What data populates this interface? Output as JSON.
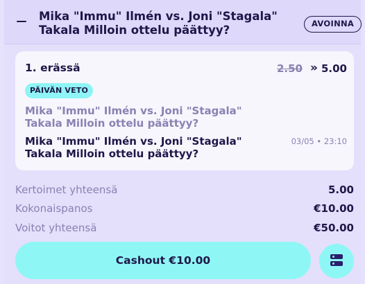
{
  "header": {
    "title": "Mika \"Immu\" Ilmén vs. Joni \"Stagala\" Takala Milloin ottelu päättyy?",
    "status_badge": "AVOINNA"
  },
  "selection": {
    "period": "1. erässä",
    "odds_old": "2.50",
    "odds_arrow": "»",
    "odds_new": "5.00",
    "promo_badge": "PÄIVÄN VETO",
    "market_muted": "Mika \"Immu\" Ilmén vs. Joni \"Stagala\" Takala Milloin ottelu päättyy?",
    "market_main": "Mika \"Immu\" Ilmén vs. Joni \"Stagala\" Takala Milloin ottelu päättyy?",
    "event_time": "03/05 • 23:10"
  },
  "summary": [
    {
      "label": "Kertoimet yhteensä",
      "value": "5.00"
    },
    {
      "label": "Kokonaispanos",
      "value": "€10.00"
    },
    {
      "label": "Voitot yhteensä",
      "value": "€50.00"
    }
  ],
  "actions": {
    "cashout_label": "Cashout €10.00",
    "slip_icon": "betslip-icon"
  },
  "colors": {
    "background": "#e4dffb",
    "header": "#ded8fb",
    "accent": "#8ef7f6",
    "text": "#1f1748",
    "muted": "#8a82b2"
  }
}
